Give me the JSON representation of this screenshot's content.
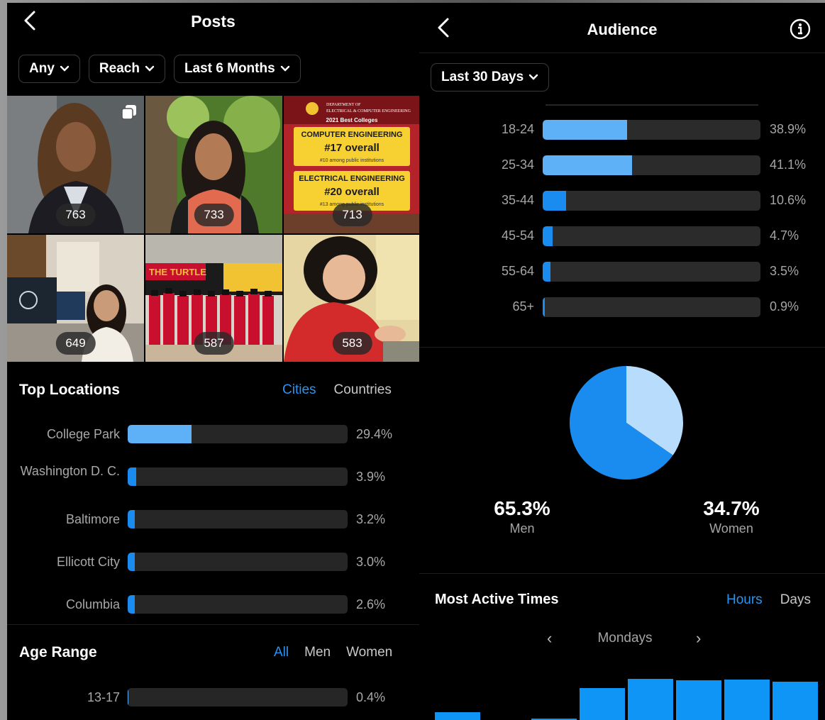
{
  "left": {
    "title": "Posts",
    "filters": [
      {
        "label": "Any"
      },
      {
        "label": "Reach"
      },
      {
        "label": "Last 6 Months"
      }
    ],
    "posts": [
      {
        "count": "763"
      },
      {
        "count": "733"
      },
      {
        "count": "713"
      },
      {
        "count": "649"
      },
      {
        "count": "587"
      },
      {
        "count": "583"
      }
    ],
    "post_graphic": {
      "header_line1": "DEPARTMENT OF",
      "header_line2": "ELECTRICAL & COMPUTER ENGINEERING",
      "ribbon": "2021 Best Colleges",
      "block1_title": "COMPUTER ENGINEERING",
      "block1_rank": "#17 overall",
      "block1_sub": "#10 among public institutions",
      "block2_title": "ELECTRICAL ENGINEERING",
      "block2_rank": "#20 overall",
      "block2_sub": "#13 among public institutions"
    },
    "banner_text": "THE TURTLE",
    "top_locations": {
      "title": "Top Locations",
      "tabs": [
        "Cities",
        "Countries"
      ],
      "active_tab": "Cities",
      "rows": [
        {
          "label": "College Park",
          "value": 29.4,
          "pct": "29.4%"
        },
        {
          "label": "Washington D. C.",
          "value": 3.9,
          "pct": "3.9%"
        },
        {
          "label": "Baltimore",
          "value": 3.2,
          "pct": "3.2%"
        },
        {
          "label": "Ellicott City",
          "value": 3.0,
          "pct": "3.0%"
        },
        {
          "label": "Columbia",
          "value": 2.6,
          "pct": "2.6%"
        }
      ]
    },
    "age_range": {
      "title": "Age Range",
      "tabs": [
        "All",
        "Men",
        "Women"
      ],
      "active_tab": "All",
      "rows": [
        {
          "label": "13-17",
          "value": 0.4,
          "pct": "0.4%"
        }
      ]
    }
  },
  "right": {
    "title": "Audience",
    "date_filter": "Last 30 Days",
    "age_rows": [
      {
        "label": "18-24",
        "value": 38.9,
        "pct": "38.9%"
      },
      {
        "label": "25-34",
        "value": 41.1,
        "pct": "41.1%"
      },
      {
        "label": "35-44",
        "value": 10.6,
        "pct": "10.6%"
      },
      {
        "label": "45-54",
        "value": 4.7,
        "pct": "4.7%"
      },
      {
        "label": "55-64",
        "value": 3.5,
        "pct": "3.5%"
      },
      {
        "label": "65+",
        "value": 0.9,
        "pct": "0.9%"
      }
    ],
    "gender": {
      "men": {
        "value": "65.3%",
        "label": "Men",
        "share": 65.3,
        "color": "#1a8cf0"
      },
      "women": {
        "value": "34.7%",
        "label": "Women",
        "share": 34.7,
        "color": "#b8dcfb"
      }
    },
    "active_times": {
      "title": "Most Active Times",
      "tabs": [
        "Hours",
        "Days"
      ],
      "active_tab": "Hours",
      "day": "Mondays",
      "bar_levels": [
        0.18,
        0.0,
        0.04,
        0.75,
        0.97,
        0.94,
        0.95,
        0.9
      ]
    }
  },
  "colors": {
    "accent": "#2a93f0",
    "bar_light": "#5eb0f7",
    "bar_dark": "#1a8cf0",
    "track": "#262626"
  }
}
